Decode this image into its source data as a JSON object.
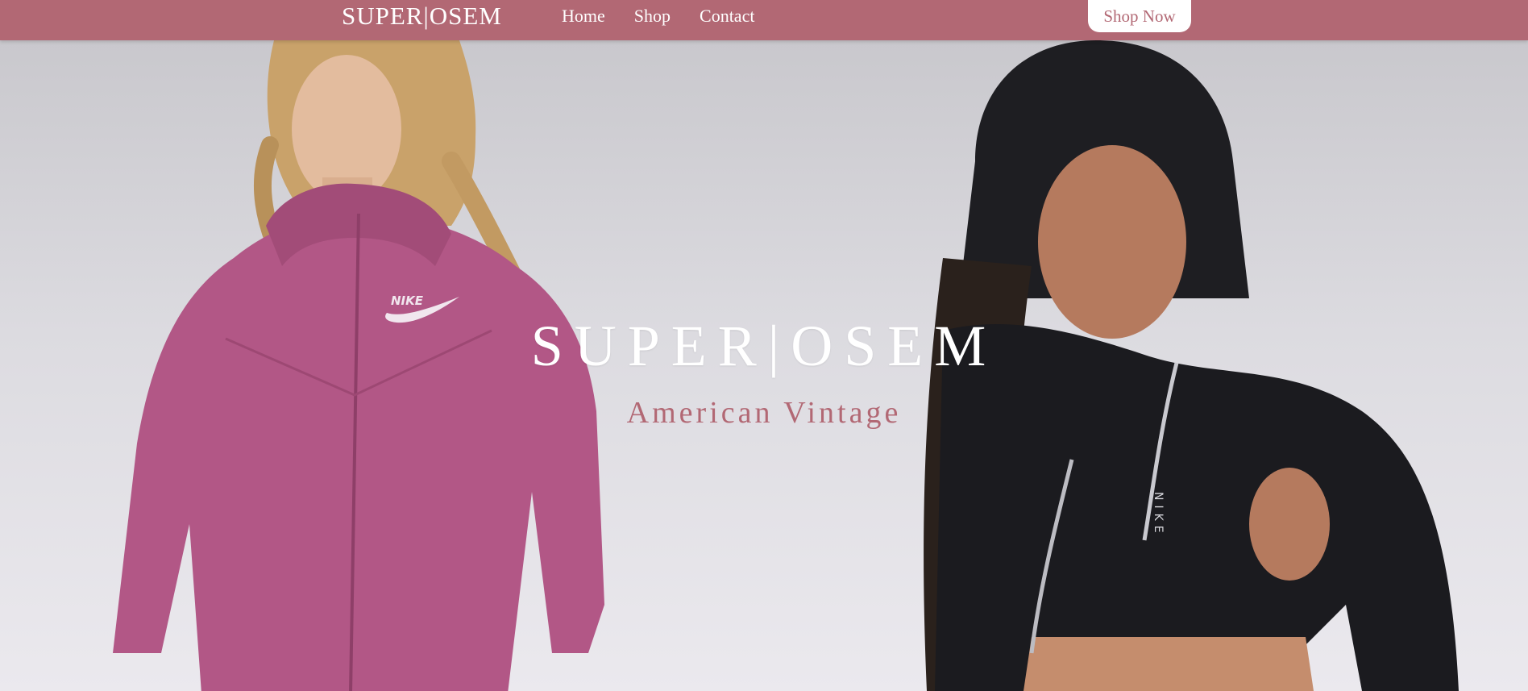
{
  "nav": {
    "brand": "SUPER|OSEM",
    "links": [
      "Home",
      "Shop",
      "Contact"
    ],
    "cta": "Shop Now"
  },
  "hero": {
    "title": "SUPER|OSEM",
    "subtitle": "American Vintage",
    "left_model_logo": "NIKE",
    "right_model_logo": "NIKE"
  },
  "colors": {
    "brand": "#b26874",
    "nav_text": "#ffffff",
    "cta_background": "#ffffff",
    "left_hoodie": "#b25786",
    "right_hoodie": "#1b1b1f",
    "background": "#dcdbe0"
  },
  "icons": [
    "nike-swoosh-logo"
  ]
}
